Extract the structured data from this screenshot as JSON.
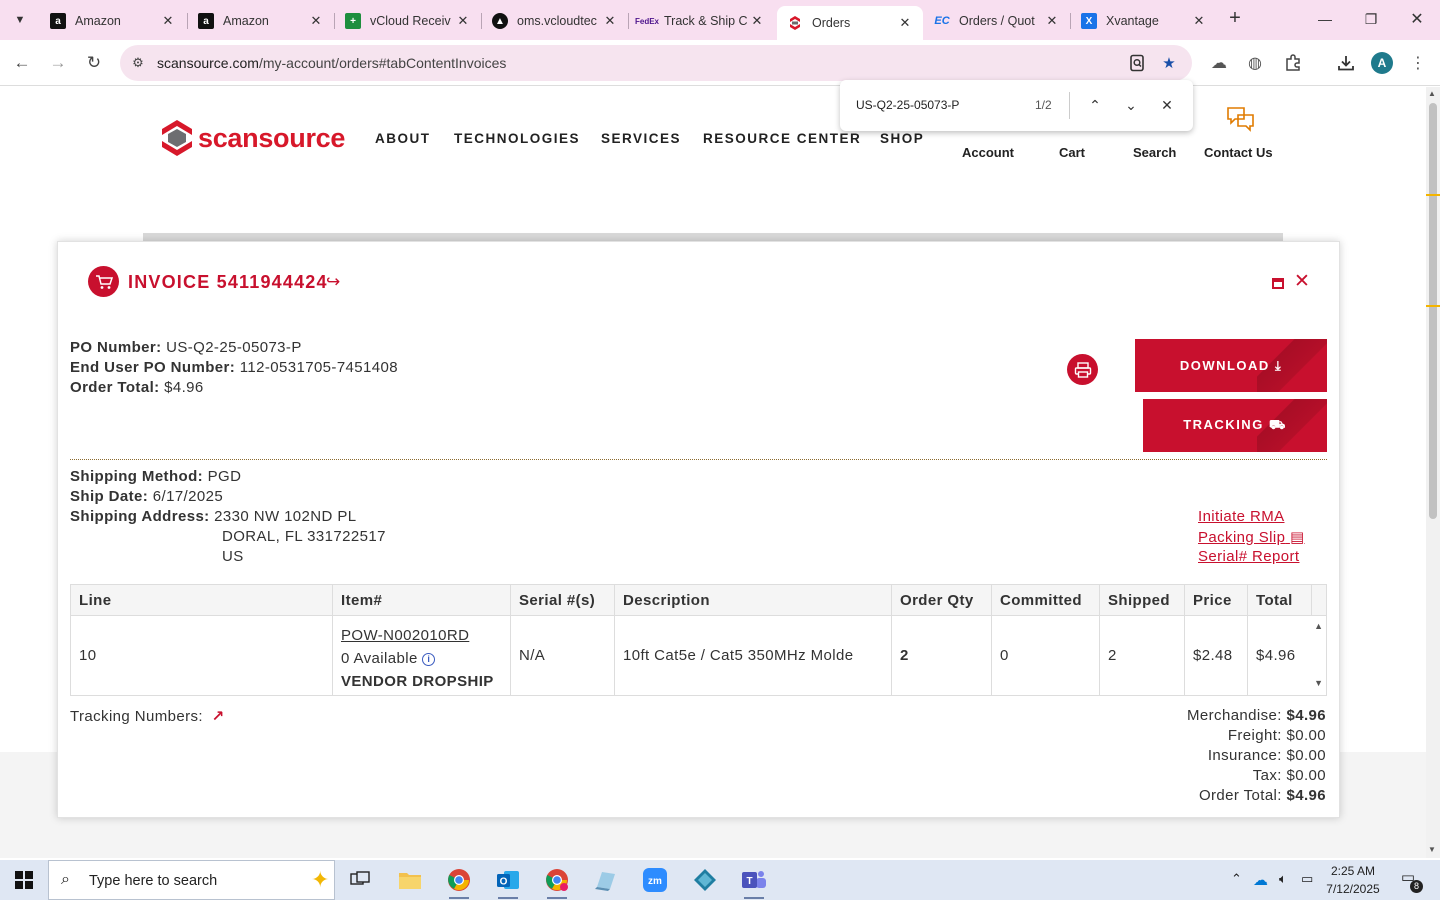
{
  "browser": {
    "tabs": [
      {
        "title": "Amazon",
        "icon": "amazon-icon"
      },
      {
        "title": "Amazon",
        "icon": "amazon-icon"
      },
      {
        "title": "vCloud Receiv",
        "icon": "spreadsheet-icon"
      },
      {
        "title": "oms.vcloudtec",
        "icon": "triangle-logo-icon"
      },
      {
        "title": "Track & Ship C",
        "icon": "fedex-icon"
      },
      {
        "title": "Orders",
        "icon": "scansource-icon",
        "active": true
      },
      {
        "title": "Orders / Quot",
        "icon": "ec-icon"
      },
      {
        "title": "Xvantage",
        "icon": "xvantage-icon"
      }
    ],
    "url_domain": "scansource.com",
    "url_path": "/my-account/orders#tabContentInvoices",
    "profile_initial": "A"
  },
  "find_bar": {
    "query": "US-Q2-25-05073-P",
    "count": "1/2"
  },
  "site": {
    "logo_text": "scansource",
    "main_nav": [
      "ABOUT",
      "TECHNOLOGIES",
      "SERVICES",
      "RESOURCE CENTER",
      "SHOP"
    ],
    "util_nav": [
      "Account",
      "Cart",
      "Search",
      "Contact Us"
    ]
  },
  "invoice": {
    "title": "INVOICE 5411944424",
    "po_label": "PO Number:",
    "po_value": "US-Q2-25-05073-P",
    "enduser_po_label": "End User PO Number:",
    "enduser_po_value": "112-0531705-7451408",
    "order_total_label": "Order Total:",
    "order_total_value": "$4.96",
    "download_label": "DOWNLOAD",
    "tracking_label": "TRACKING",
    "shipping_method_label": "Shipping Method:",
    "shipping_method_value": "PGD",
    "ship_date_label": "Ship Date:",
    "ship_date_value": "6/17/2025",
    "shipping_address_label": "Shipping Address:",
    "address_line1": "2330 NW 102ND PL",
    "address_line2": "DORAL, FL 331722517",
    "address_line3": "US",
    "links": {
      "rma": "Initiate RMA",
      "packing_slip": "Packing Slip",
      "serial_report": "Serial# Report"
    },
    "table": {
      "headers": [
        "Line",
        "Item#",
        "Serial #(s)",
        "Description",
        "Order Qty",
        "Committed",
        "Shipped",
        "Price",
        "Total"
      ],
      "rows": [
        {
          "line": "10",
          "item": "POW-N002010RD",
          "available": "0 Available",
          "vendor": "VENDOR DROPSHIP",
          "serial": "N/A",
          "description": "10ft Cat5e / Cat5 350MHz Molde",
          "order_qty": "2",
          "committed": "0",
          "shipped": "2",
          "price": "$2.48",
          "total": "$4.96"
        }
      ]
    },
    "tracking_numbers_label": "Tracking Numbers:",
    "totals": {
      "merchandise_label": "Merchandise:",
      "merchandise_value": "$4.96",
      "freight_label": "Freight:",
      "freight_value": "$0.00",
      "insurance_label": "Insurance:",
      "insurance_value": "$0.00",
      "tax_label": "Tax:",
      "tax_value": "$0.00",
      "order_total_label": "Order Total:",
      "order_total_value": "$4.96"
    }
  },
  "taskbar": {
    "search_placeholder": "Type here to search",
    "time": "2:25 AM",
    "date": "7/12/2025",
    "notification_count": "8"
  },
  "colors": {
    "brand_red": "#c8102e",
    "tabstrip_bg": "#f8dff0"
  }
}
